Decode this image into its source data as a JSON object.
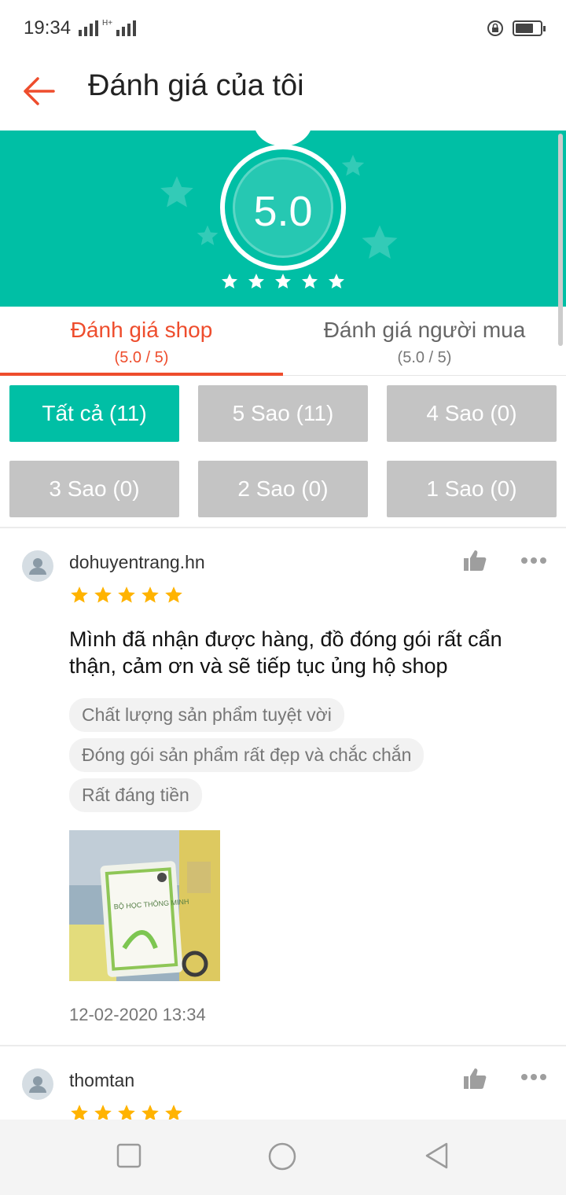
{
  "status_bar": {
    "time": "19:34",
    "network_label": "H+",
    "icons": [
      "signal-icon",
      "signal-icon",
      "screen-lock-icon",
      "battery-icon"
    ]
  },
  "header": {
    "back_icon": "arrow-left-icon",
    "title": "Đánh giá của tôi"
  },
  "summary": {
    "score": "5.0",
    "stars": 5,
    "star_color": "#ffffff",
    "background": "#00bfa5"
  },
  "tabs": [
    {
      "label": "Đánh giá shop",
      "sub": "(5.0 / 5)",
      "active": true
    },
    {
      "label": "Đánh giá người mua",
      "sub": "(5.0 / 5)",
      "active": false
    }
  ],
  "filters": [
    {
      "label": "Tất cả (11)",
      "active": true
    },
    {
      "label": "5 Sao (11)",
      "active": false
    },
    {
      "label": "4 Sao (0)",
      "active": false
    },
    {
      "label": "3 Sao (0)",
      "active": false
    },
    {
      "label": "2 Sao (0)",
      "active": false
    },
    {
      "label": "1 Sao (0)",
      "active": false
    }
  ],
  "reviews": [
    {
      "username": "dohuyentrang.hn",
      "rating": 5,
      "comment": "Mình đã nhận được hàng, đồ đóng gói rất cẩn thận, cảm ơn và sẽ tiếp tục ủng hộ shop",
      "tags": [
        "Chất lượng sản phẩm tuyệt vời",
        "Đóng gói sản phẩm rất đẹp và chắc chắn",
        "Rất đáng tiền"
      ],
      "photo_text": "BỘ HỌC THÔNG MINH",
      "date": "12-02-2020 13:34"
    },
    {
      "username": "thomtan",
      "rating": 5
    }
  ],
  "colors": {
    "accent": "#ee4d2d",
    "teal": "#00bfa5",
    "star": "#ffb300",
    "chip_inactive": "#c4c4c4"
  },
  "nav_bar": {
    "icons": [
      "recent-apps-icon",
      "home-icon",
      "back-icon"
    ]
  }
}
